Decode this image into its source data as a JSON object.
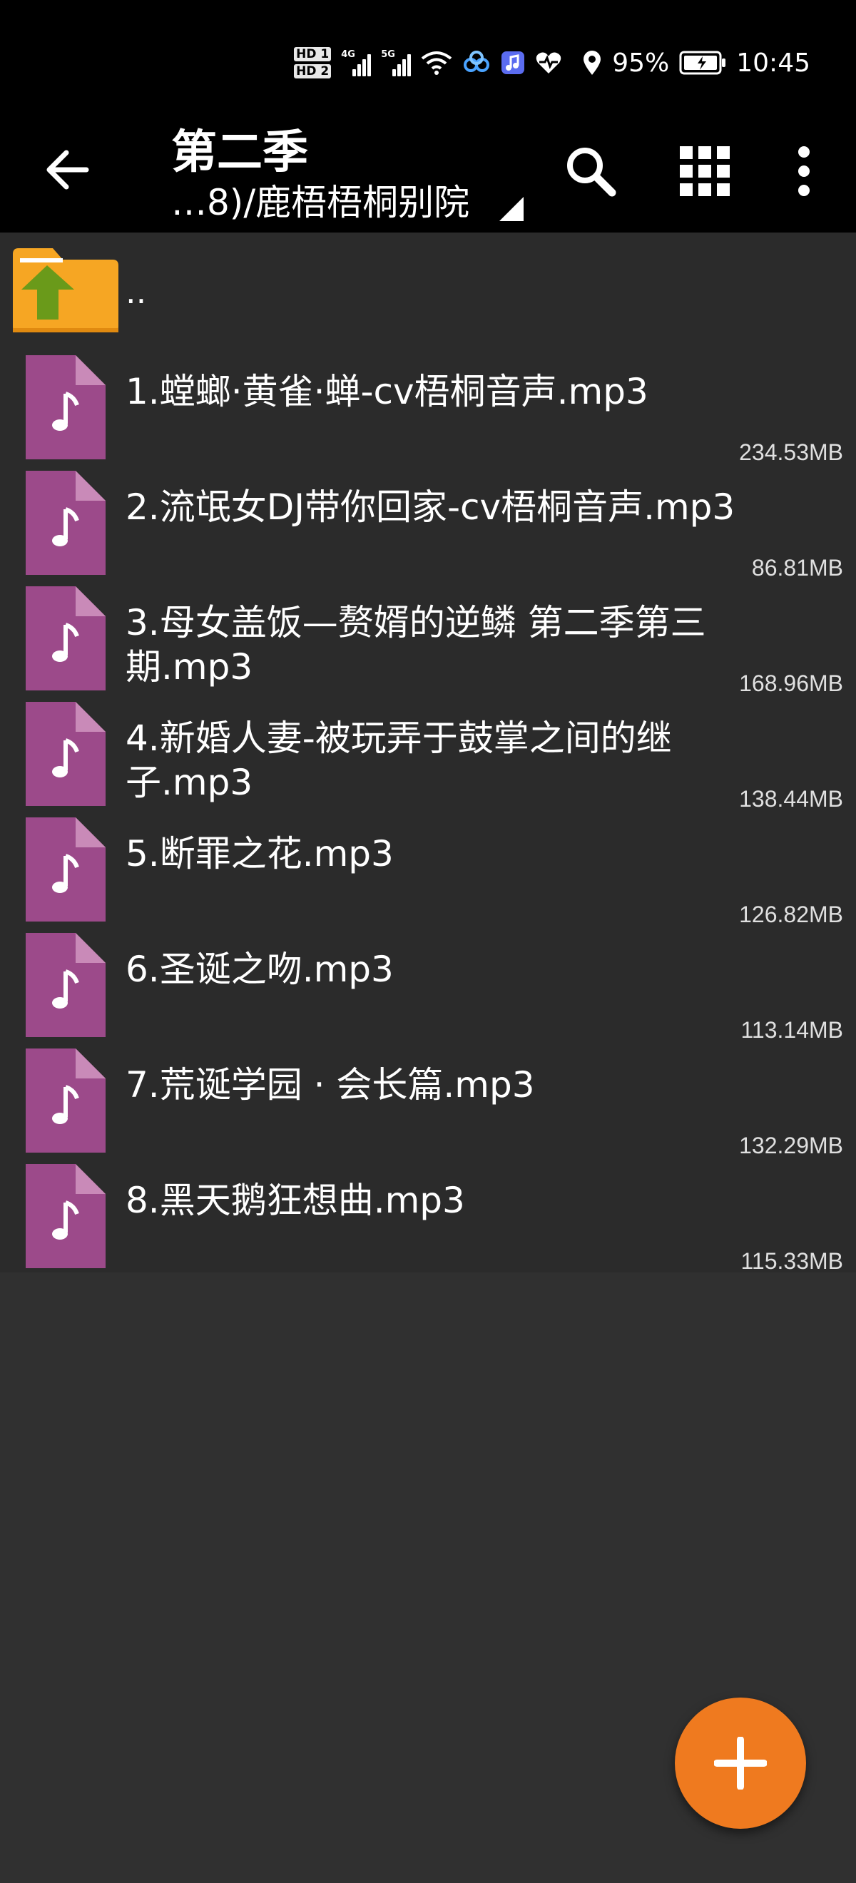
{
  "status_bar": {
    "hd1": "HD 1",
    "hd2": "HD 2",
    "net1": "4G",
    "net2": "5G",
    "battery_percent": "95%",
    "time": "10:45",
    "icons": [
      "wifi-icon",
      "link-app-icon",
      "music-app-icon",
      "health-icon",
      "location-icon",
      "battery-icon"
    ]
  },
  "toolbar": {
    "title": "第二季",
    "path": "…8)/鹿梧梧桐别院",
    "icons": [
      "back-arrow-icon",
      "search-icon",
      "grid-view-icon",
      "more-vert-icon"
    ]
  },
  "parent_folder": {
    "label": ".."
  },
  "files": [
    {
      "name": "1.螳螂·黄雀·蝉-cv梧桐音声.mp3",
      "size": "234.53MB"
    },
    {
      "name": "2.流氓女DJ带你回家-cv梧桐音声.mp3",
      "size": "86.81MB"
    },
    {
      "name": "3.母女盖饭—赘婿的逆鳞 第二季第三期.mp3",
      "size": "168.96MB"
    },
    {
      "name": "4.新婚人妻-被玩弄于鼓掌之间的继子.mp3",
      "size": "138.44MB"
    },
    {
      "name": "5.断罪之花.mp3",
      "size": "126.82MB"
    },
    {
      "name": "6.圣诞之吻.mp3",
      "size": "113.14MB"
    },
    {
      "name": "7.荒诞学园 · 会长篇.mp3",
      "size": "132.29MB"
    },
    {
      "name": "8.黑天鹅狂想曲.mp3",
      "size": "115.33MB"
    }
  ],
  "fab": {
    "icon": "plus-icon"
  },
  "colors": {
    "bar_bg": "#000000",
    "list_bg": "#2b2b2b",
    "page_bg": "#303030",
    "audio_file": "#9c4a8a",
    "folder": "#f6a623",
    "folder_arrow": "#6a9a1a",
    "fab": "#ef7a1f"
  }
}
